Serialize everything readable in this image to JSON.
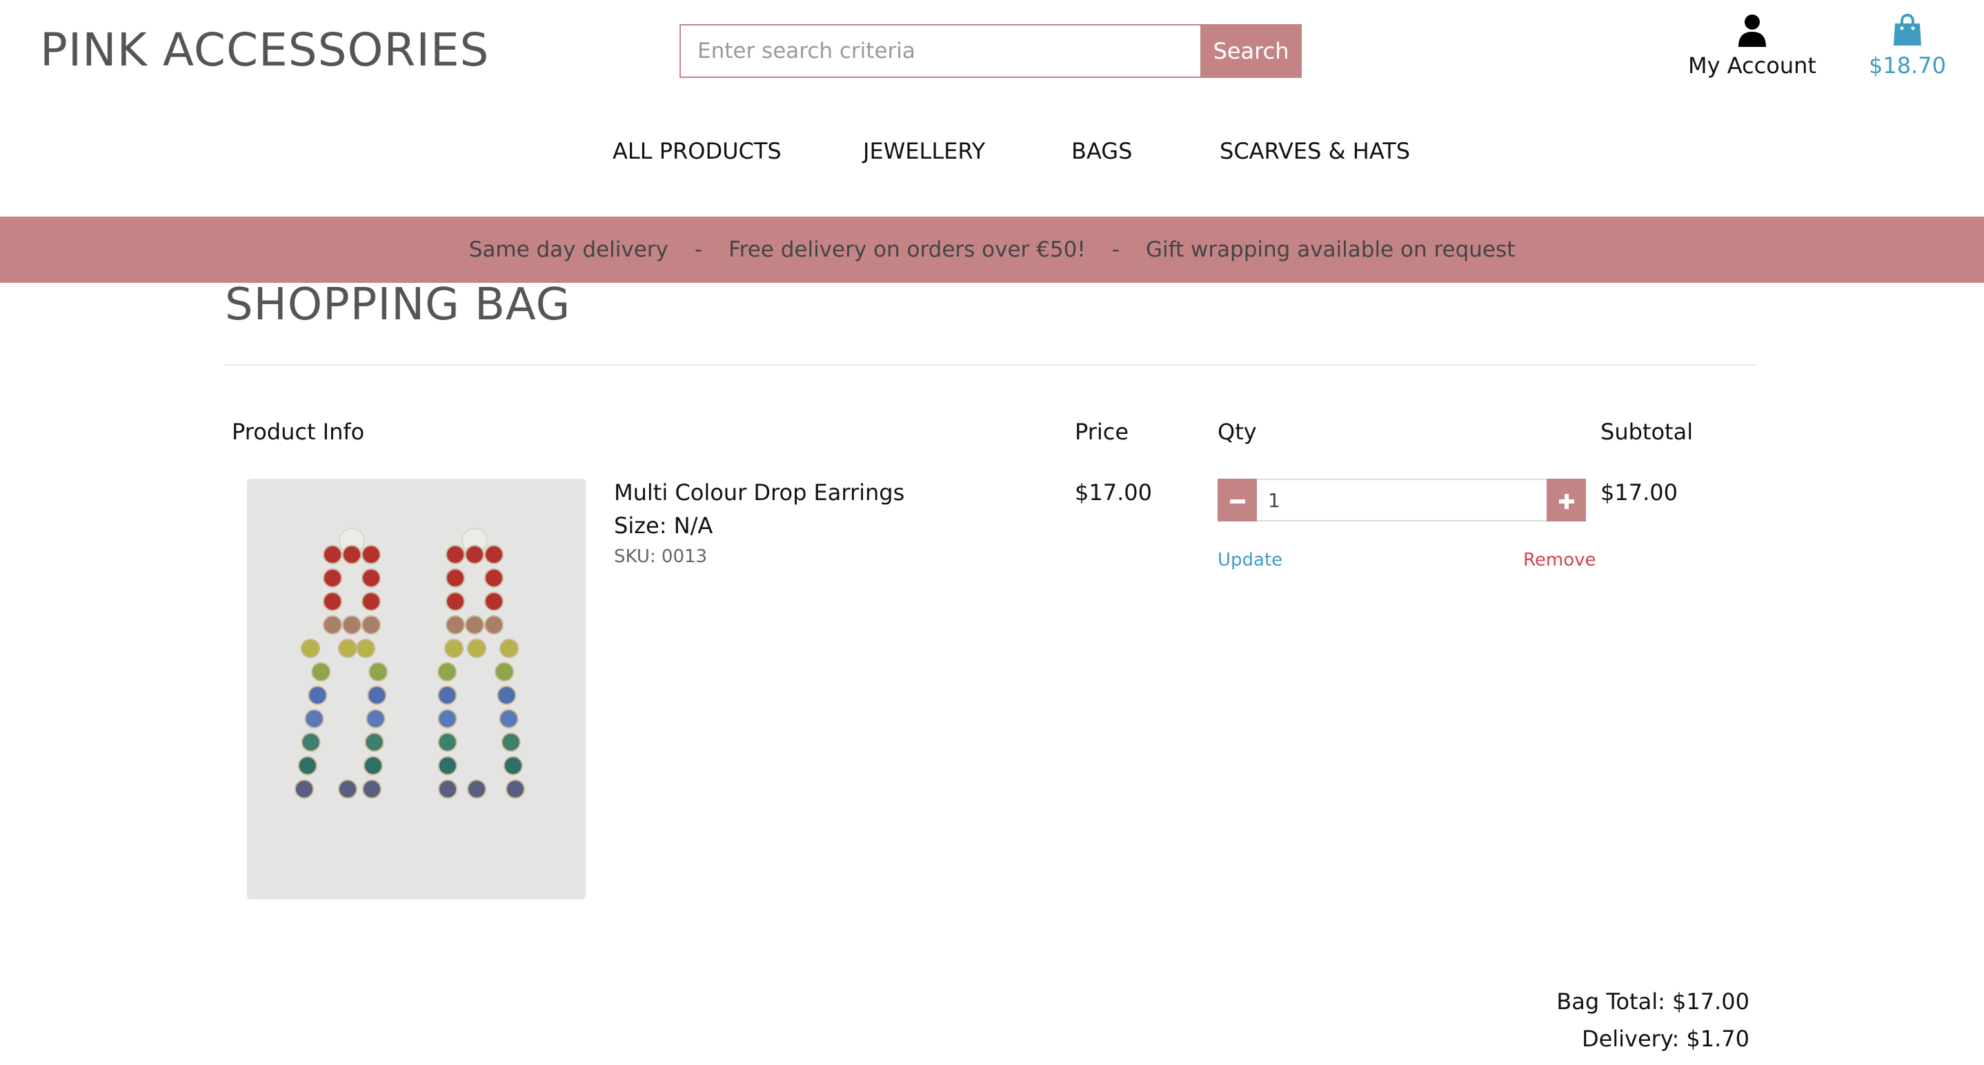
{
  "header": {
    "brand": "PINK ACCESSORIES",
    "search": {
      "placeholder": "Enter search criteria",
      "value": "",
      "button_label": "Search"
    },
    "account_label": "My Account",
    "bag_total": "$18.70"
  },
  "nav": {
    "items": [
      {
        "label": "ALL PRODUCTS"
      },
      {
        "label": "JEWELLERY"
      },
      {
        "label": "BAGS"
      },
      {
        "label": "SCARVES & HATS"
      }
    ]
  },
  "banner": {
    "messages": [
      "Same day delivery",
      "Free delivery on orders over €50!",
      "Gift wrapping available on request"
    ],
    "separator": "-"
  },
  "page": {
    "title": "SHOPPING BAG",
    "columns": {
      "product": "Product Info",
      "price": "Price",
      "qty": "Qty",
      "subtotal": "Subtotal"
    },
    "items": [
      {
        "name": "Multi Colour Drop Earrings",
        "size": "Size: N/A",
        "sku": "SKU: 0013",
        "price": "$17.00",
        "qty": "1",
        "subtotal": "$17.00",
        "update_label": "Update",
        "remove_label": "Remove"
      }
    ],
    "summary": {
      "bag_total": "Bag Total: $17.00",
      "delivery": "Delivery: $1.70"
    }
  },
  "colors": {
    "accent_pink": "#c48486",
    "link_blue": "#3e9cc0",
    "remove_red": "#d0454c"
  },
  "icons": {
    "account": "user-icon",
    "bag": "shopping-bag-icon",
    "minus": "minus-icon",
    "plus": "plus-icon"
  }
}
